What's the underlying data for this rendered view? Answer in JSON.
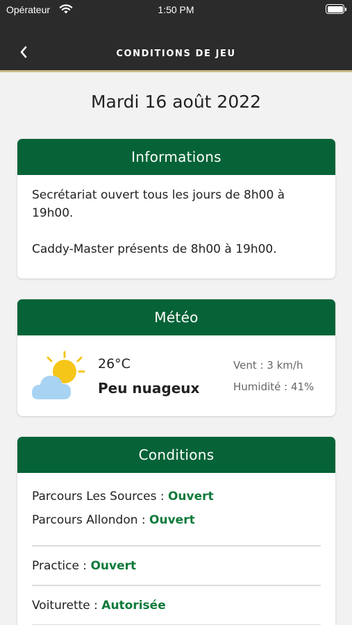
{
  "status_bar": {
    "carrier": "Opérateur",
    "time": "1:50 PM"
  },
  "nav": {
    "title": "CONDITIONS DE JEU",
    "back_icon": "chevron-left-icon"
  },
  "date": "Mardi 16 août 2022",
  "colors": {
    "header_bg": "#2b2b2b",
    "accent_line": "#c9b98a",
    "card_header_green": "#056337",
    "status_green": "#0e7a3a"
  },
  "informations": {
    "title": "Informations",
    "line1": "Secrétariat ouvert tous les jours de 8h00 à 19h00.",
    "line2": "Caddy-Master présents de 8h00 à 19h00."
  },
  "meteo": {
    "title": "Météo",
    "icon": "partly-cloudy-icon",
    "temperature": "26°C",
    "sky": "Peu nuageux",
    "wind": "Vent : 3 km/h",
    "humidity": "Humidité : 41%"
  },
  "conditions": {
    "title": "Conditions",
    "rows": [
      {
        "label": "Parcours Les Sources : ",
        "value": "Ouvert"
      },
      {
        "label": "Parcours Allondon : ",
        "value": "Ouvert"
      },
      {
        "label": "Practice  : ",
        "value": "Ouvert"
      },
      {
        "label": "Voiturette  : ",
        "value": "Autorisée"
      }
    ]
  }
}
